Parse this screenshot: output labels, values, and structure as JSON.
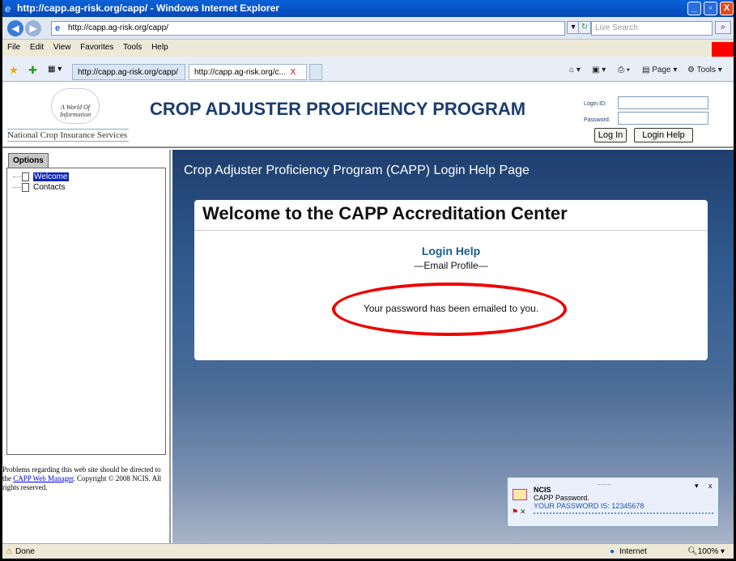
{
  "window": {
    "title": "http://capp.ag-risk.org/capp/ - Windows Internet Explorer",
    "minimize": "_",
    "maximize": "▫",
    "close": "X"
  },
  "address_bar": {
    "url": "http://capp.ag-risk.org/capp/",
    "search_placeholder": "Live Search"
  },
  "menu": [
    "File",
    "Edit",
    "View",
    "Favorites",
    "Tools",
    "Help"
  ],
  "tabs": [
    {
      "label": "http://capp.ag-risk.org/capp/"
    },
    {
      "label": "http://capp.ag-risk.org/c...",
      "close": "X"
    }
  ],
  "command_bar": {
    "page": "Page",
    "tools": "Tools"
  },
  "header": {
    "logo_tagline": "A World Of Information",
    "logo_name": "National Crop Insurance Services",
    "title": "CROP ADJUSTER PROFICIENCY PROGRAM",
    "login_id_label": "Login ID:",
    "password_label": "Password:",
    "login_button": "Log In",
    "help_button": "Login Help"
  },
  "sidebar": {
    "options_tab": "Options",
    "items": [
      {
        "label": "Welcome",
        "selected": true
      },
      {
        "label": "Contacts",
        "selected": false
      }
    ],
    "footer_text_1": "Problems regarding this web site should be directed to the ",
    "footer_link": "CAPP Web Manager",
    "footer_text_2": ". Copyright © 2008 NCIS. All rights reserved."
  },
  "main": {
    "page_title": "Crop Adjuster Proficiency Program (CAPP) Login Help Page",
    "card_title": "Welcome to the CAPP Accreditation Center",
    "help_heading": "Login Help",
    "help_sub": "—Email Profile—",
    "message": "Your password has been emailed to you."
  },
  "notification": {
    "sender": "NCIS",
    "subject": "CAPP Password.",
    "body": "YOUR PASSWORD IS: 12345678",
    "grip": "........",
    "dropdown": "▾",
    "close": "x"
  },
  "status_bar": {
    "status": "Done",
    "zone": "Internet",
    "zoom": "100%"
  },
  "colors": {
    "accent": "#0a62d8",
    "title_navy": "#1c3d6e",
    "highlight_ellipse": "#e00000",
    "red_block": "#ff0000"
  }
}
